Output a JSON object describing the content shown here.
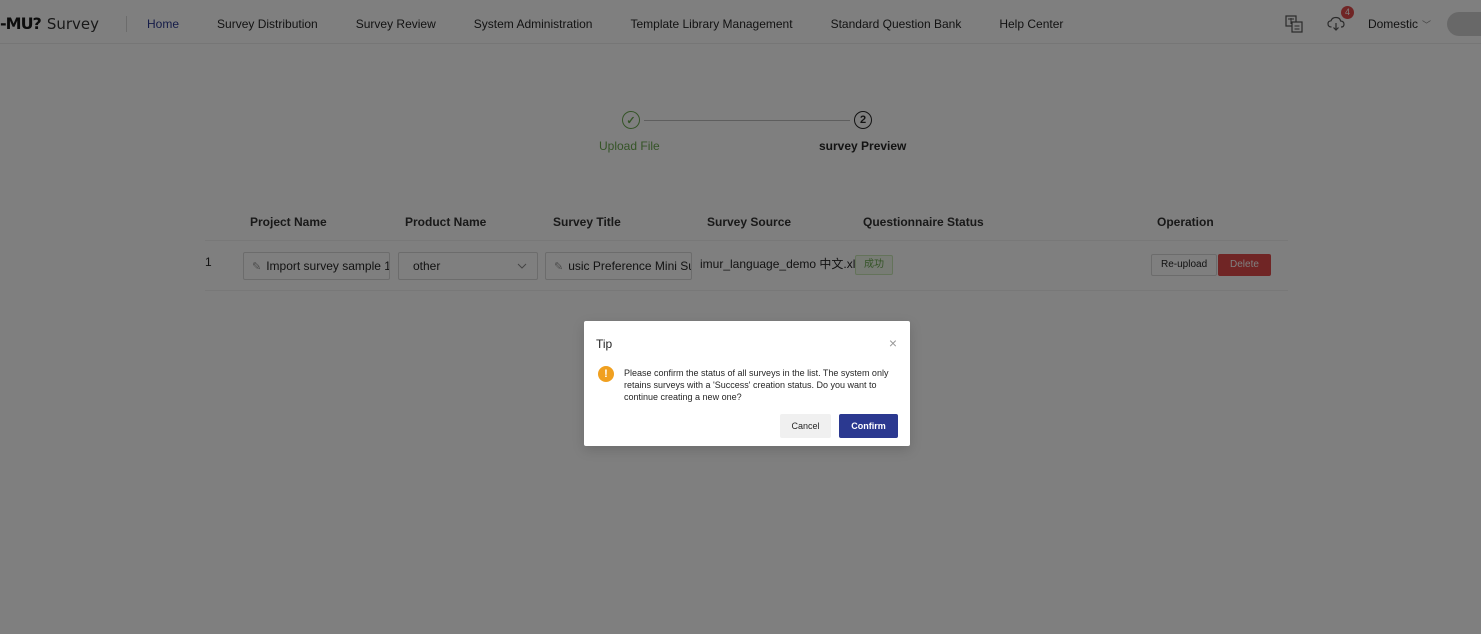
{
  "header": {
    "logo_mark": "-MU?",
    "logo_text": "Survey",
    "nav": [
      {
        "label": "Home",
        "active": true
      },
      {
        "label": "Survey Distribution"
      },
      {
        "label": "Survey Review"
      },
      {
        "label": "System Administration"
      },
      {
        "label": "Template Library Management"
      },
      {
        "label": "Standard Question Bank"
      },
      {
        "label": "Help Center"
      }
    ],
    "translate_icon": "translate-icon",
    "download_icon": "cloud-download-icon",
    "download_badge": "4",
    "region": "Domestic",
    "region_chevron": "﹀"
  },
  "steps": [
    {
      "number": "✓",
      "label": "Upload File",
      "status": "finished",
      "color": "#6aa84f"
    },
    {
      "number": "2",
      "label": "survey Preview",
      "status": "current"
    }
  ],
  "table": {
    "columns": [
      "Project Name",
      "Product Name",
      "Survey Title",
      "Survey Source",
      "Questionnaire Status",
      "Operation"
    ],
    "rows": [
      {
        "index": "1",
        "project_name": "Import survey sample 1",
        "product_name": "other",
        "survey_title": "usic Preference Mini Su",
        "survey_source": "imur_language_demo 中文.xl...",
        "status": "成功",
        "reupload_label": "Re-upload",
        "delete_label": "Delete"
      }
    ]
  },
  "modal": {
    "title": "Tip",
    "close": "×",
    "icon": "!",
    "message": "Please confirm the status of all surveys in the list. The system only retains surveys with a 'Success' creation status. Do you want to continue creating a new one?",
    "cancel_label": "Cancel",
    "confirm_label": "Confirm"
  },
  "colors": {
    "primary": "#2b3990",
    "success": "#6aa84f",
    "danger": "#e04a4a",
    "warning": "#f0a020"
  }
}
